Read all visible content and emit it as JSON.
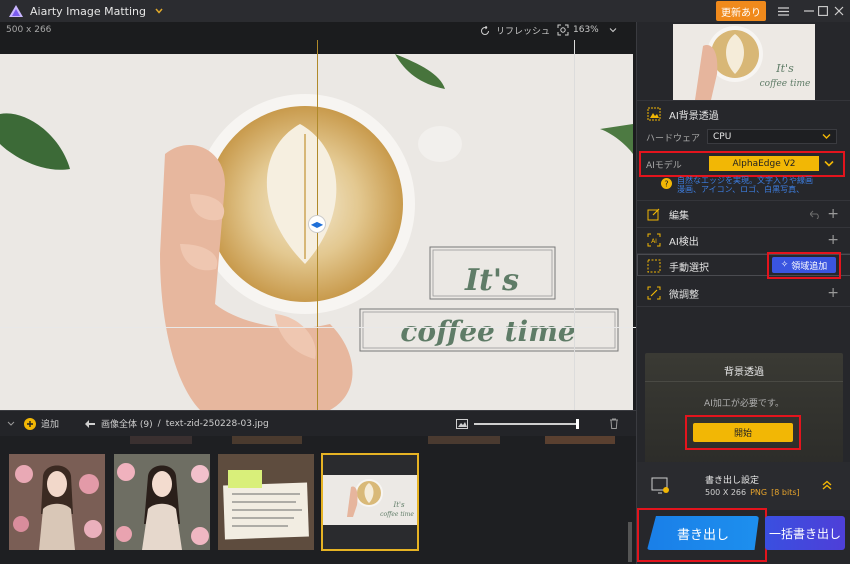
{
  "titlebar": {
    "app_title": "Aiarty Image Matting",
    "update_badge": "更新あり"
  },
  "canvas": {
    "image_size": "500 x 266",
    "refresh_label": "リフレッシュ",
    "zoom_level": "163%",
    "photo_text_line1": "It's",
    "photo_text_line2": "coffee time"
  },
  "filebar": {
    "add_label": "追加",
    "all_images_label": "画像全体 (9)",
    "path_separator": "/",
    "current_file": "text-zid-250228-03.jpg",
    "thumbnail_text_line1": "It's",
    "thumbnail_text_line2": "coffee time"
  },
  "panel": {
    "preview_text_line1": "It's",
    "preview_text_line2": "coffee time",
    "ai_bg_title": "AI背景透過",
    "hardware_label": "ハードウェア",
    "hardware_value": "CPU",
    "ai_model_label": "AIモデル",
    "ai_model_value": "AlphaEdge V2",
    "model_note_line1": "自然なエッジを実現。文字入りや線画",
    "model_note_line2": "漫画、アイコン、ロゴ、白黒写真、",
    "sections": {
      "edit": "編集",
      "ai_detect": "AI検出",
      "manual_select": "手動選択",
      "region_add": "領域追加",
      "fine_tune": "微調整"
    },
    "bg_card": {
      "title": "背景透過",
      "message": "AI加工が必要です。",
      "start": "開始"
    },
    "export_settings": {
      "title": "書き出し設定",
      "size": "500 X 266",
      "format": "PNG",
      "bits": "[8 bits]"
    },
    "export_button": "書き出し",
    "batch_export_button": "一括書き出し"
  }
}
